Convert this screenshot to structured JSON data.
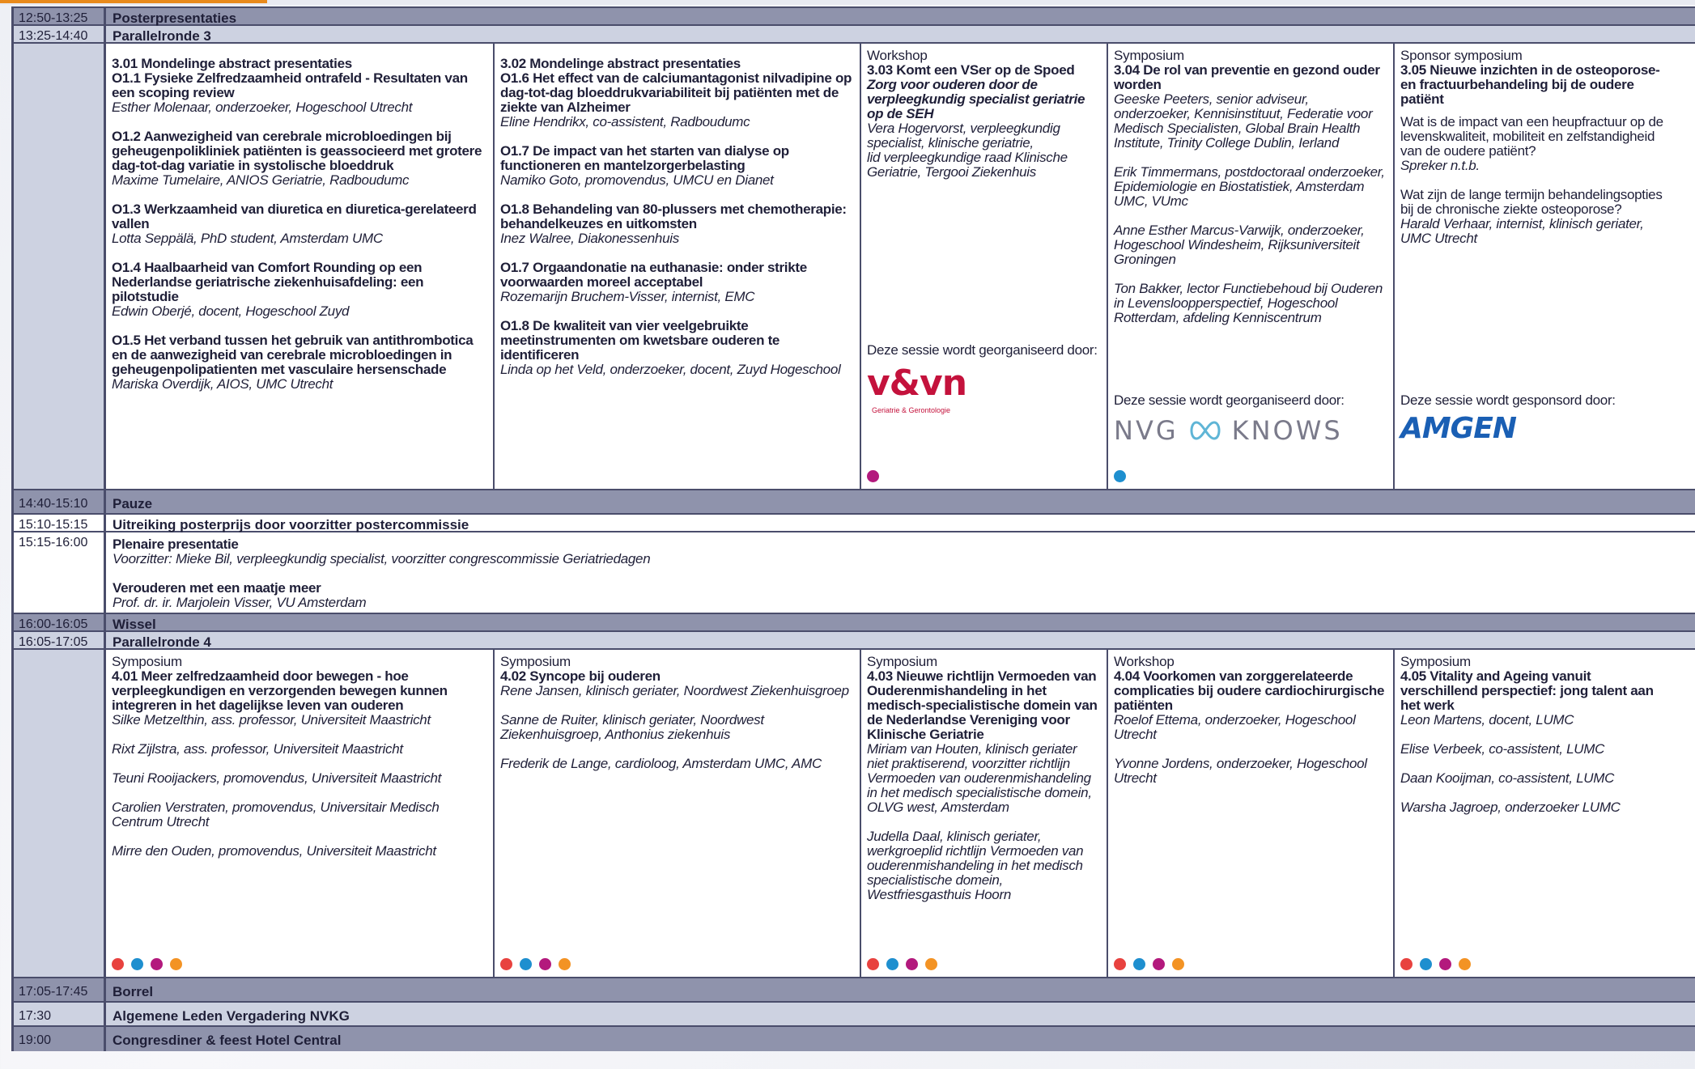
{
  "colors": {
    "grid": "#4a4d6b",
    "dark_row": "#8f93ac",
    "mid_row": "#cdd2e1",
    "dot_red": "#e8423f",
    "dot_blue": "#1e8fcf",
    "dot_magenta": "#b3197d",
    "dot_orange": "#f39324",
    "vvn": "#c4123c",
    "amgen": "#1a5fb4"
  },
  "rows": {
    "r1": {
      "time": "12:50-13:25",
      "label": "Posterpresentaties"
    },
    "r2": {
      "time": "13:25-14:40",
      "label": "Parallelronde 3"
    },
    "r4": {
      "time": "14:40-15:10",
      "label": "Pauze"
    },
    "r5": {
      "time": "15:10-15:15",
      "label": "Uitreiking posterprijs door voorzitter postercommissie"
    },
    "r6": {
      "time": "15:15-16:00",
      "title": "Plenaire presentatie",
      "chair": "Voorzitter: Mieke Bil, verpleegkundig specialist, voorzitter congrescommissie Geriatriedagen",
      "talk": "Verouderen met een maatje meer",
      "speaker": "Prof. dr. ir. Marjolein Visser, VU Amsterdam"
    },
    "r7": {
      "time": "16:00-16:05",
      "label": "Wissel"
    },
    "r8": {
      "time": "16:05-17:05",
      "label": "Parallelronde 4"
    },
    "r10": {
      "time": "17:05-17:45",
      "label": "Borrel"
    },
    "r11": {
      "time": "17:30",
      "label": "Algemene Leden Vergadering NVKG"
    },
    "r12": {
      "time": "19:00",
      "label": "Congresdiner & feest Hotel Central"
    }
  },
  "p3": {
    "s1": {
      "title1": "3.01 Mondelinge abstract presentaties",
      "title2": "O1.1 Fysieke Zelfredzaamheid ontrafeld - Resultaten van een scoping review",
      "sp1": "Esther Molenaar, onderzoeker, Hogeschool Utrecht",
      "t2": "O1.2 Aanwezigheid van cerebrale microbloedingen bij geheugenpolikliniek patiënten is geassocieerd met grotere dag-tot-dag variatie in systolische bloeddruk",
      "sp2": "Maxime Tumelaire, ANIOS Geriatrie, Radboudumc",
      "t3": "O1.3 Werkzaamheid van diuretica en diuretica-gerelateerd vallen",
      "sp3": "Lotta Seppälä, PhD student, Amsterdam UMC",
      "t4": "O1.4 Haalbaarheid van Comfort Rounding op een Nederlandse geriatrische ziekenhuisafdeling: een pilotstudie",
      "sp4": "Edwin Oberjé, docent, Hogeschool Zuyd",
      "t5": "O1.5 Het verband tussen het gebruik van antithrombotica en de aanwezigheid van cerebrale microbloedingen in geheugenpolipatienten met vasculaire hersenschade",
      "sp5": "Mariska Overdijk, AIOS, UMC Utrecht"
    },
    "s2": {
      "title1": "3.02 Mondelinge abstract presentaties",
      "title2": "O1.6 Het effect van de calciumantagonist nilvadipine op dag-tot-dag bloeddrukvariabiliteit bij patiënten met de ziekte van Alzheimer",
      "sp1": "Eline Hendrikx, co-assistent, Radboudumc",
      "t2": "O1.7 De impact van het starten van dialyse op functioneren en mantelzorgerbelasting",
      "sp2": "Namiko Goto, promovendus, UMCU en Dianet",
      "t3": "O1.8 Behandeling van 80-plussers met chemotherapie: behandelkeuzes en uitkomsten",
      "sp3": "Inez Walree, Diakonessenhuis",
      "t4": "O1.7 Orgaandonatie na euthanasie: onder strikte voorwaarden moreel acceptabel",
      "sp4": "Rozemarijn Bruchem-Visser, internist, EMC",
      "t5": "O1.8 De kwaliteit van vier veelgebruikte meetinstrumenten om kwetsbare ouderen te identificeren",
      "sp5": "Linda op het Veld, onderzoeker, docent, Zuyd Hogeschool"
    },
    "s3": {
      "type": "Workshop",
      "title_a": "3.03 Komt een VSer op de Spoed ",
      "title_b": "Zorg voor ouderen door de verpleegkundig specialist geriatrie op de SEH",
      "sp1": "Vera Hogervorst, verpleegkundig specialist, klinische geriatrie,",
      "sp1b": "lid verpleegkundige raad Klinische Geriatrie, Tergooi Ziekenhuis",
      "org": "Deze sessie wordt georganiseerd door:",
      "logo": "v&vn",
      "logo_sub": "Geriatrie & Gerontologie"
    },
    "s4": {
      "type": "Symposium",
      "title": "3.04 De rol van preventie en gezond ouder worden",
      "sp1": "Geeske Peeters, senior adviseur, onderzoeker, Kennisinstituut, Federatie voor Medisch Specialisten, Global Brain Health Institute, Trinity College Dublin, Ierland",
      "sp2": "Erik Timmermans, postdoctoraal onderzoeker, Epidemiologie en Biostatistiek, Amsterdam UMC, VUmc",
      "sp3": "Anne Esther Marcus-Varwijk, onderzoeker, Hogeschool Windesheim, Rijksuniversiteit Groningen",
      "sp4": "Ton Bakker, lector Functiebehoud bij Ouderen in Levensloopperspectief, Hogeschool Rotterdam, afdeling Kenniscentrum",
      "org": "Deze sessie wordt georganiseerd door:",
      "logo_left": "NVG",
      "logo_right": "KNOWS"
    },
    "s5": {
      "type": "Sponsor symposium",
      "title": "3.05 Nieuwe inzichten in de osteoporose- en fractuurbehandeling bij de oudere patiënt",
      "q1": "Wat is de impact van een heupfractuur op de levenskwaliteit, mobiliteit en zelfstandigheid van de oudere patiënt?",
      "sp1": "Spreker n.t.b.",
      "q2": "Wat zijn de lange termijn behandelingsopties bij de chronische ziekte osteoporose?",
      "sp2": "Harald Verhaar, internist, klinisch geriater, UMC Utrecht",
      "org": "Deze sessie wordt gesponsord door:",
      "logo": "AMGEN"
    }
  },
  "p4": {
    "s1": {
      "type": "Symposium",
      "title": "4.01 Meer zelfredzaamheid door bewegen - hoe verpleegkundigen en verzorgenden bewegen kunnen integreren in het dagelijkse leven van ouderen",
      "sp1": "Silke Metzelthin, ass. professor, Universiteit Maastricht",
      "sp2": "Rixt Zijlstra, ass. professor, Universiteit Maastricht",
      "sp3": "Teuni Rooijackers, promovendus, Universiteit Maastricht",
      "sp4": "Carolien Verstraten, promovendus, Universitair Medisch Centrum Utrecht",
      "sp5": "Mirre den Ouden, promovendus, Universiteit Maastricht"
    },
    "s2": {
      "type": "Symposium",
      "title": "4.02 Syncope bij ouderen",
      "sp1": "Rene Jansen, klinisch geriater, Noordwest Ziekenhuisgroep",
      "sp2": "Sanne de Ruiter, klinisch geriater, Noordwest Ziekenhuisgroep, Anthonius ziekenhuis",
      "sp3": "Frederik de Lange, cardioloog, Amsterdam UMC, AMC"
    },
    "s3": {
      "type": "Symposium",
      "title": "4.03 Nieuwe richtlijn Vermoeden van Ouderenmishandeling in het medisch-specialistische domein van de Nederlandse Vereniging voor Klinische Geriatrie",
      "sp1": "Miriam van Houten, klinisch geriater niet praktiserend, voorzitter richtlijn Vermoeden van ouderenmishandeling in het medisch specialistische domein, OLVG west, Amsterdam",
      "sp2": "Judella Daal, klinisch geriater, werkgroeplid richtlijn Vermoeden van ouderenmishandeling in het medisch specialistische domein, Westfriesgasthuis Hoorn"
    },
    "s4": {
      "type": "Workshop",
      "title": "4.04 Voorkomen van zorggerelateerde complicaties bij oudere cardiochirurgische patiënten",
      "sp1": "Roelof Ettema, onderzoeker, Hogeschool Utrecht",
      "sp2": "Yvonne Jordens, onderzoeker, Hogeschool Utrecht"
    },
    "s5": {
      "type": "Symposium",
      "title": "4.05 Vitality and Ageing vanuit verschillend perspectief: jong talent aan het werk",
      "sp1": "Leon Martens, docent, LUMC",
      "sp2": "Elise Verbeek, co-assistent, LUMC",
      "sp3": "Daan Kooijman, co-assistent, LUMC",
      "sp4": "Warsha Jagroep, onderzoeker LUMC"
    }
  }
}
